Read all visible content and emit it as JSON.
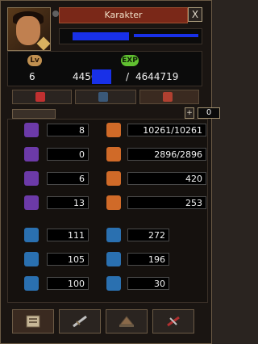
{
  "title": "Karakter",
  "close_glyph": "X",
  "level": {
    "label": "Lv",
    "value": "6"
  },
  "exp": {
    "label": "EXP",
    "value": "44567",
    "max": "4644719",
    "separator": "/"
  },
  "counter": {
    "plus": "+",
    "value": "0"
  },
  "stats_left": [
    "8",
    "0",
    "6",
    "13"
  ],
  "stats_right": [
    "10261/10261",
    "2896/2896",
    "420",
    "253"
  ],
  "stats_blue_left": [
    "111",
    "105",
    "100"
  ],
  "stats_blue_right": [
    "272",
    "196",
    "30"
  ],
  "icons": [
    "bar-icon",
    "x-icon",
    "orb-icon",
    "sword-icon",
    "hat-icon",
    "scroll-icon"
  ]
}
